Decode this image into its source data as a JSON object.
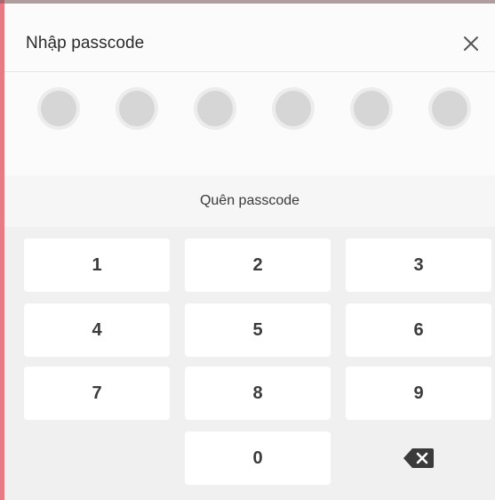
{
  "dialog": {
    "title": "Nhập passcode",
    "close_icon": "close-icon"
  },
  "passcode": {
    "length": 6,
    "entered": 0
  },
  "forgot": {
    "label": "Quên passcode"
  },
  "keypad": {
    "keys": [
      "1",
      "2",
      "3",
      "4",
      "5",
      "6",
      "7",
      "8",
      "9",
      "0"
    ],
    "delete_icon": "backspace-icon"
  },
  "colors": {
    "accent": "#e87a86",
    "dot": "#d6d6d6",
    "key_bg": "#ffffff"
  }
}
